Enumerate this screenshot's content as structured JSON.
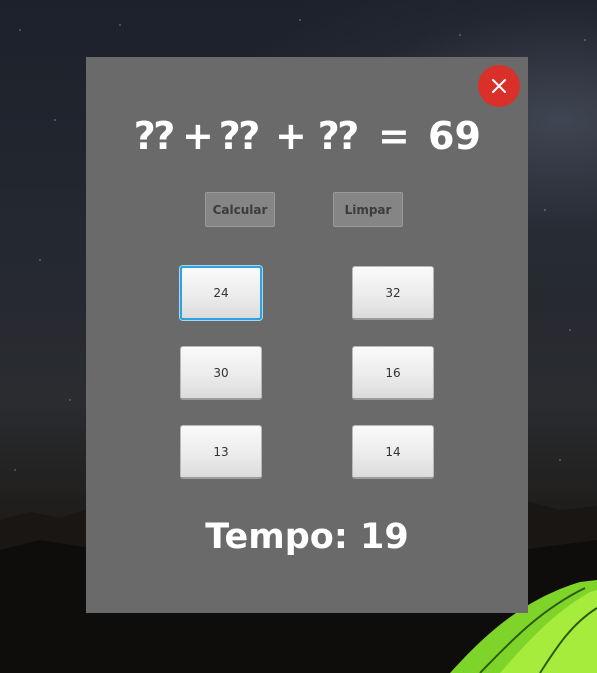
{
  "equation": {
    "slot_1": "⁇",
    "plus_1": "+",
    "slot_2": "⁇",
    "plus_2": "+",
    "slot_3": "⁇",
    "equals": "=",
    "result": "69"
  },
  "actions": {
    "calculate_label": "Calcular",
    "clear_label": "Limpar"
  },
  "numbers": [
    "24",
    "32",
    "30",
    "16",
    "13",
    "14"
  ],
  "focused_number_index": 0,
  "timer": {
    "label": "Tempo: 19"
  },
  "colors": {
    "panel": "#6a6a6a",
    "close_button": "#d9302a",
    "focus_ring": "#2aa3e0"
  },
  "icons": {
    "close": "close-icon"
  }
}
